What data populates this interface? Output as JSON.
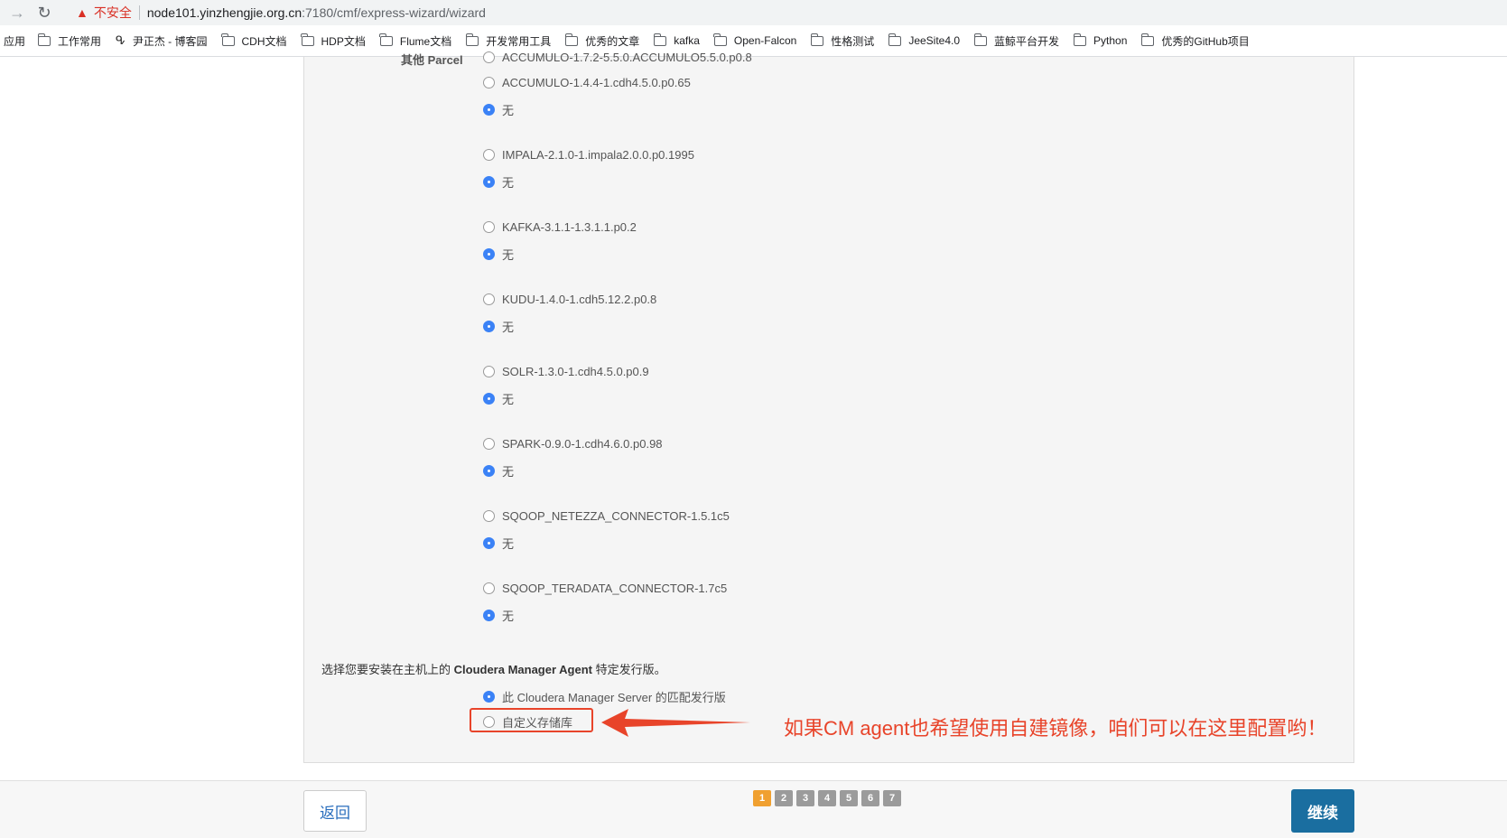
{
  "browser": {
    "insecure_label": "不安全",
    "url_host": "node101.yinzhengjie.org.cn",
    "url_path": ":7180/cmf/express-wizard/wizard"
  },
  "bookmarks": {
    "apps_label": "应用",
    "items": [
      "工作常用",
      "尹正杰 - 博客园",
      "CDH文档",
      "HDP文档",
      "Flume文档",
      "开发常用工具",
      "优秀的文章",
      "kafka",
      "Open-Falcon",
      "性格测试",
      "JeeSite4.0",
      "蓝鲸平台开发",
      "Python",
      "优秀的GitHub项目"
    ]
  },
  "parcels": {
    "label": "其他 Parcel",
    "partial_top": "ACCUMULO-1.7.2-5.5.0.ACCUMULO5.5.0.p0.8",
    "none_label": "无",
    "groups": [
      {
        "option": "ACCUMULO-1.4.4-1.cdh4.5.0.p0.65"
      },
      {
        "option": "IMPALA-2.1.0-1.impala2.0.0.p0.1995"
      },
      {
        "option": "KAFKA-3.1.1-1.3.1.1.p0.2"
      },
      {
        "option": "KUDU-1.4.0-1.cdh5.12.2.p0.8"
      },
      {
        "option": "SOLR-1.3.0-1.cdh4.5.0.p0.9"
      },
      {
        "option": "SPARK-0.9.0-1.cdh4.6.0.p0.98"
      },
      {
        "option": "SQOOP_NETEZZA_CONNECTOR-1.5.1c5"
      },
      {
        "option": "SQOOP_TERADATA_CONNECTOR-1.7c5"
      }
    ]
  },
  "agent": {
    "title_prefix": "选择您要安装在主机上的 ",
    "title_bold": "Cloudera Manager Agent",
    "title_suffix": " 特定发行版。",
    "option_matched": "此 Cloudera Manager Server 的匹配发行版",
    "option_custom": "自定义存储库"
  },
  "annotation": {
    "text": "如果CM agent也希望使用自建镜像，咱们可以在这里配置哟！",
    "color": "#e8442a"
  },
  "footer": {
    "back_label": "返回",
    "continue_label": "继续",
    "pages": [
      "1",
      "2",
      "3",
      "4",
      "5",
      "6",
      "7"
    ],
    "active_page": "1"
  }
}
